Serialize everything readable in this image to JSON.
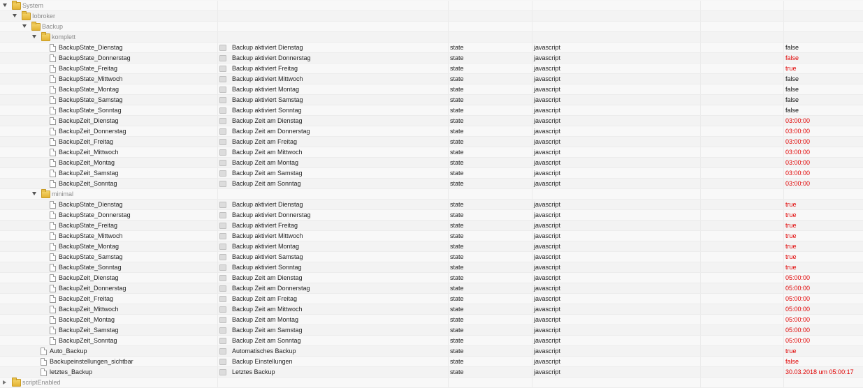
{
  "tree": {
    "system_label": "System",
    "iobroker_label": "Iobroker",
    "backup_label": "Backup",
    "komplett_label": "komplett",
    "minimal_label": "minimal",
    "script_enabled_label": "scriptEnabled",
    "komplett_items": [
      {
        "name": "BackupState_Dienstag",
        "desc": "Backup aktiviert Dienstag",
        "type": "state",
        "role": "javascript",
        "value": "false",
        "value_color": "black"
      },
      {
        "name": "BackupState_Donnerstag",
        "desc": "Backup aktiviert Donnerstag",
        "type": "state",
        "role": "javascript",
        "value": "false",
        "value_color": "red"
      },
      {
        "name": "BackupState_Freitag",
        "desc": "Backup aktiviert Freitag",
        "type": "state",
        "role": "javascript",
        "value": "true",
        "value_color": "red"
      },
      {
        "name": "BackupState_Mittwoch",
        "desc": "Backup aktiviert Mittwoch",
        "type": "state",
        "role": "javascript",
        "value": "false",
        "value_color": "black"
      },
      {
        "name": "BackupState_Montag",
        "desc": "Backup aktiviert Montag",
        "type": "state",
        "role": "javascript",
        "value": "false",
        "value_color": "black"
      },
      {
        "name": "BackupState_Samstag",
        "desc": "Backup aktiviert Samstag",
        "type": "state",
        "role": "javascript",
        "value": "false",
        "value_color": "black"
      },
      {
        "name": "BackupState_Sonntag",
        "desc": "Backup aktiviert Sonntag",
        "type": "state",
        "role": "javascript",
        "value": "false",
        "value_color": "black"
      },
      {
        "name": "BackupZeit_Dienstag",
        "desc": "Backup Zeit am Dienstag",
        "type": "state",
        "role": "javascript",
        "value": "03:00:00",
        "value_color": "red"
      },
      {
        "name": "BackupZeit_Donnerstag",
        "desc": "Backup Zeit am Donnerstag",
        "type": "state",
        "role": "javascript",
        "value": "03:00:00",
        "value_color": "red"
      },
      {
        "name": "BackupZeit_Freitag",
        "desc": "Backup Zeit am Freitag",
        "type": "state",
        "role": "javascript",
        "value": "03:00:00",
        "value_color": "red"
      },
      {
        "name": "BackupZeit_Mittwoch",
        "desc": "Backup Zeit am Mittwoch",
        "type": "state",
        "role": "javascript",
        "value": "03:00:00",
        "value_color": "red"
      },
      {
        "name": "BackupZeit_Montag",
        "desc": "Backup Zeit am Montag",
        "type": "state",
        "role": "javascript",
        "value": "03:00:00",
        "value_color": "red"
      },
      {
        "name": "BackupZeit_Samstag",
        "desc": "Backup Zeit am Samstag",
        "type": "state",
        "role": "javascript",
        "value": "03:00:00",
        "value_color": "red"
      },
      {
        "name": "BackupZeit_Sonntag",
        "desc": "Backup Zeit am Sonntag",
        "type": "state",
        "role": "javascript",
        "value": "03:00:00",
        "value_color": "red"
      }
    ],
    "minimal_items": [
      {
        "name": "BackupState_Dienstag",
        "desc": "Backup aktiviert Dienstag",
        "type": "state",
        "role": "javascript",
        "value": "true",
        "value_color": "red"
      },
      {
        "name": "BackupState_Donnerstag",
        "desc": "Backup aktiviert Donnerstag",
        "type": "state",
        "role": "javascript",
        "value": "true",
        "value_color": "red"
      },
      {
        "name": "BackupState_Freitag",
        "desc": "Backup aktiviert Freitag",
        "type": "state",
        "role": "javascript",
        "value": "true",
        "value_color": "red"
      },
      {
        "name": "BackupState_Mittwoch",
        "desc": "Backup aktiviert Mittwoch",
        "type": "state",
        "role": "javascript",
        "value": "true",
        "value_color": "red"
      },
      {
        "name": "BackupState_Montag",
        "desc": "Backup aktiviert Montag",
        "type": "state",
        "role": "javascript",
        "value": "true",
        "value_color": "red"
      },
      {
        "name": "BackupState_Samstag",
        "desc": "Backup aktiviert Samstag",
        "type": "state",
        "role": "javascript",
        "value": "true",
        "value_color": "red"
      },
      {
        "name": "BackupState_Sonntag",
        "desc": "Backup aktiviert Sonntag",
        "type": "state",
        "role": "javascript",
        "value": "true",
        "value_color": "red"
      },
      {
        "name": "BackupZeit_Dienstag",
        "desc": "Backup Zeit am Dienstag",
        "type": "state",
        "role": "javascript",
        "value": "05:00:00",
        "value_color": "red"
      },
      {
        "name": "BackupZeit_Donnerstag",
        "desc": "Backup Zeit am Donnerstag",
        "type": "state",
        "role": "javascript",
        "value": "05:00:00",
        "value_color": "red"
      },
      {
        "name": "BackupZeit_Freitag",
        "desc": "Backup Zeit am Freitag",
        "type": "state",
        "role": "javascript",
        "value": "05:00:00",
        "value_color": "red"
      },
      {
        "name": "BackupZeit_Mittwoch",
        "desc": "Backup Zeit am Mittwoch",
        "type": "state",
        "role": "javascript",
        "value": "05:00:00",
        "value_color": "red"
      },
      {
        "name": "BackupZeit_Montag",
        "desc": "Backup Zeit am Montag",
        "type": "state",
        "role": "javascript",
        "value": "05:00:00",
        "value_color": "red"
      },
      {
        "name": "BackupZeit_Samstag",
        "desc": "Backup Zeit am Samstag",
        "type": "state",
        "role": "javascript",
        "value": "05:00:00",
        "value_color": "red"
      },
      {
        "name": "BackupZeit_Sonntag",
        "desc": "Backup Zeit am Sonntag",
        "type": "state",
        "role": "javascript",
        "value": "05:00:00",
        "value_color": "red"
      }
    ],
    "backup_items": [
      {
        "name": "Auto_Backup",
        "desc": "Automatisches Backup",
        "type": "state",
        "role": "javascript",
        "value": "true",
        "value_color": "red"
      },
      {
        "name": "Backupeinstellungen_sichtbar",
        "desc": "Backup Einstellungen",
        "type": "state",
        "role": "javascript",
        "value": "false",
        "value_color": "red"
      },
      {
        "name": "letztes_Backup",
        "desc": "Letztes Backup",
        "type": "state",
        "role": "javascript",
        "value": "30.03.2018 um 05:00:17",
        "value_color": "red"
      }
    ]
  },
  "colors": {
    "value_red": "#e00000",
    "folder": "#e3b332"
  }
}
